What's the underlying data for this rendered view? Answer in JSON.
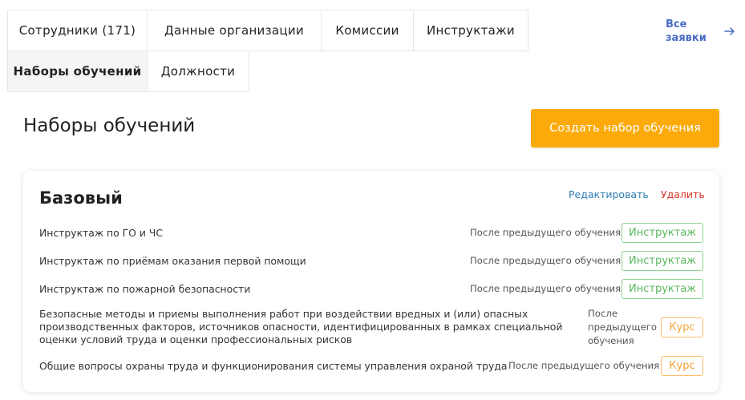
{
  "tabs": [
    {
      "label": "Сотрудники (171)"
    },
    {
      "label": "Данные организации"
    },
    {
      "label": "Комиссии"
    },
    {
      "label": "Инструктажи"
    },
    {
      "label": "Наборы обучений",
      "active": true
    },
    {
      "label": "Должности"
    }
  ],
  "header": {
    "all_requests_line1": "Все",
    "all_requests_line2": "заявки",
    "arrow_icon": "arrow-right-icon"
  },
  "main": {
    "title": "Наборы обучений",
    "create_button": "Создать набор обучения"
  },
  "card": {
    "title": "Базовый",
    "edit_label": "Редактировать",
    "delete_label": "Удалить",
    "items": [
      {
        "name": "Инструктаж по ГО и ЧС",
        "when": "После предыдущего обучения",
        "type": "Инструктаж"
      },
      {
        "name": "Инструктаж по приёмам оказания первой помощи",
        "when": "После предыдущего обучения",
        "type": "Инструктаж"
      },
      {
        "name": "Инструктаж по пожарной безопасности",
        "when": "После предыдущего обучения",
        "type": "Инструктаж"
      },
      {
        "name_lines": [
          "Безопасные методы и приемы выполнения работ при воздействии вредных и (или) опасных",
          "производственных факторов, источников опасности, идентифицированных в рамках специальной",
          "оценки условий труда и оценки профессиональных рисков"
        ],
        "when_lines": [
          "После",
          "предыдущего",
          "обучения"
        ],
        "type": "Курс"
      },
      {
        "name": "Общие вопросы охраны труда и функционирования системы управления охраной труда",
        "when": "После предыдущего обучения",
        "type": "Курс"
      }
    ]
  },
  "colors": {
    "accent_orange": "#fcaa0a",
    "link_blue": "#2e7db5",
    "delete_red": "#d8352a",
    "badge_green": "#5bb85d",
    "badge_orange": "#f5a236",
    "all_requests_blue": "#4a6cc3"
  }
}
